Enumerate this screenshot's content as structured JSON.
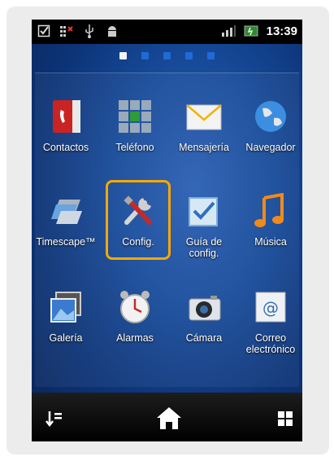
{
  "status_bar": {
    "time": "13:39",
    "icons_left": [
      "checkbox-icon",
      "missed-call-icon",
      "usb-icon",
      "android-icon"
    ],
    "icons_right": [
      "signal-icon",
      "battery-icon"
    ]
  },
  "pager": {
    "pages": 5,
    "active": 0
  },
  "apps": [
    {
      "label": "Contactos",
      "icon": "contacts-icon"
    },
    {
      "label": "Teléfono",
      "icon": "phone-keypad-icon"
    },
    {
      "label": "Mensajería",
      "icon": "envelope-icon"
    },
    {
      "label": "Navegador",
      "icon": "globe-icon"
    },
    {
      "label": "Timescape™",
      "icon": "timescape-icon"
    },
    {
      "label": "Config.",
      "icon": "tools-icon"
    },
    {
      "label": "Guía de config.",
      "icon": "checkbox-icon"
    },
    {
      "label": "Música",
      "icon": "music-note-icon"
    },
    {
      "label": "Galería",
      "icon": "gallery-icon"
    },
    {
      "label": "Alarmas",
      "icon": "alarm-clock-icon"
    },
    {
      "label": "Cámara",
      "icon": "camera-icon"
    },
    {
      "label": "Correo electrónico",
      "icon": "email-icon"
    }
  ],
  "highlighted_app": "Config.",
  "highlight_color": "#f7a800",
  "bottom_bar": [
    "app-list-icon",
    "home-icon",
    "grid-icon"
  ]
}
